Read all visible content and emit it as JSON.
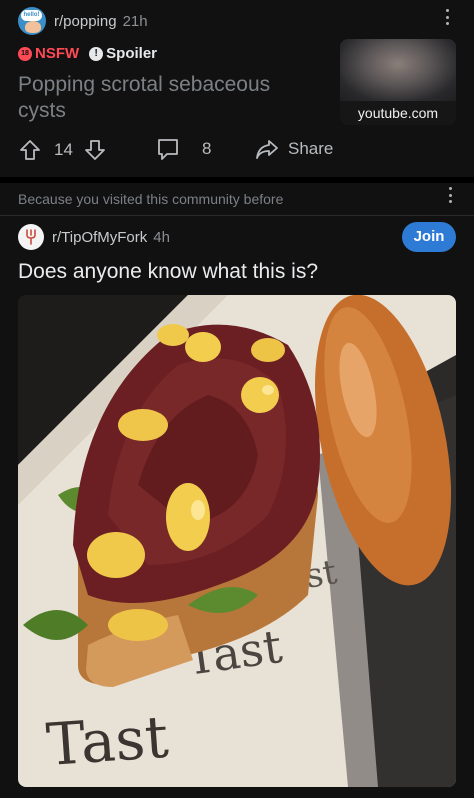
{
  "post1": {
    "community": "r/popping",
    "time": "21h",
    "avatar_badge": "hello!",
    "nsfw_label": "NSFW",
    "nsfw_badge": "18",
    "spoiler_label": "Spoiler",
    "spoiler_badge": "!",
    "title": "Popping scrotal sebaceous cysts",
    "thumbnail_domain": "youtube.com",
    "upvotes": "14",
    "comments": "8",
    "share_label": "Share"
  },
  "post2": {
    "reason": "Because you visited this community before",
    "community": "r/TipOfMyFork",
    "time": "4h",
    "join_label": "Join",
    "title": "Does anyone know what this is?",
    "image_icon": "photo-food-toast",
    "paper_text": "Tast"
  },
  "colors": {
    "background": "#0b0b0c",
    "card": "#111112",
    "nsfw": "#ff4a55",
    "join": "#2e7bd6",
    "muted_text": "#7c8084"
  }
}
